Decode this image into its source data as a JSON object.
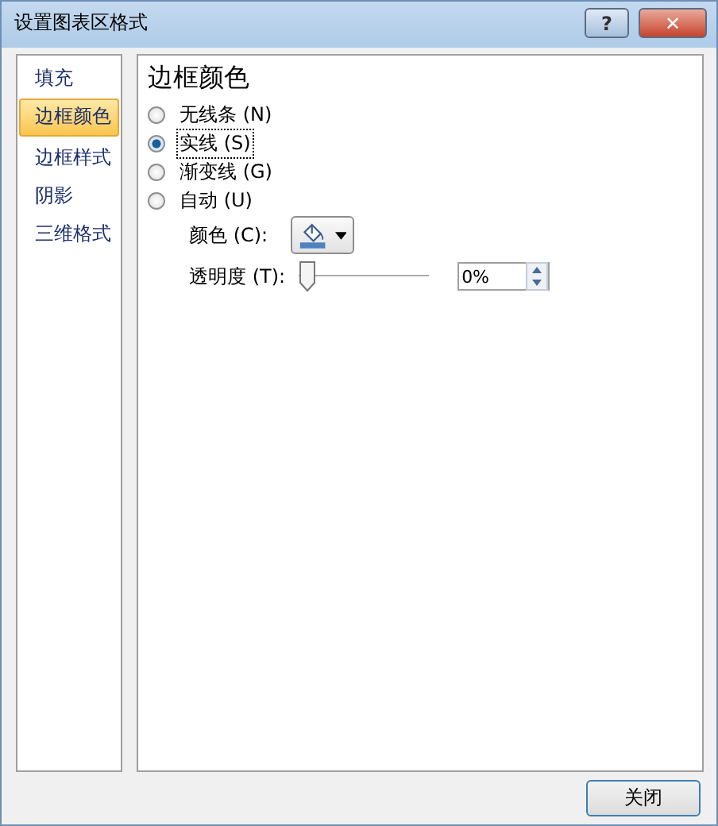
{
  "window": {
    "title": "设置图表区格式",
    "buttons": [
      {
        "kind": "help",
        "label": "?"
      },
      {
        "kind": "close",
        "label": "✕"
      }
    ]
  },
  "sidebar": {
    "items": [
      {
        "label": "填充",
        "selected": false
      },
      {
        "label": "边框颜色",
        "selected": true
      },
      {
        "label": "边框样式",
        "selected": false
      },
      {
        "label": "阴影",
        "selected": false
      },
      {
        "label": "三维格式",
        "selected": false
      }
    ]
  },
  "panel": {
    "heading": "边框颜色",
    "options": [
      {
        "label": "无线条 (N)",
        "selected": false
      },
      {
        "label": "实线 (S)",
        "selected": true
      },
      {
        "label": "渐变线 (G)",
        "selected": false
      },
      {
        "label": "自动 (U)",
        "selected": false
      }
    ],
    "color": {
      "label": "颜色 (C):"
    },
    "transparency": {
      "label": "透明度 (T):",
      "level": 0,
      "value": "0%"
    }
  },
  "buttons": [
    "关闭"
  ]
}
